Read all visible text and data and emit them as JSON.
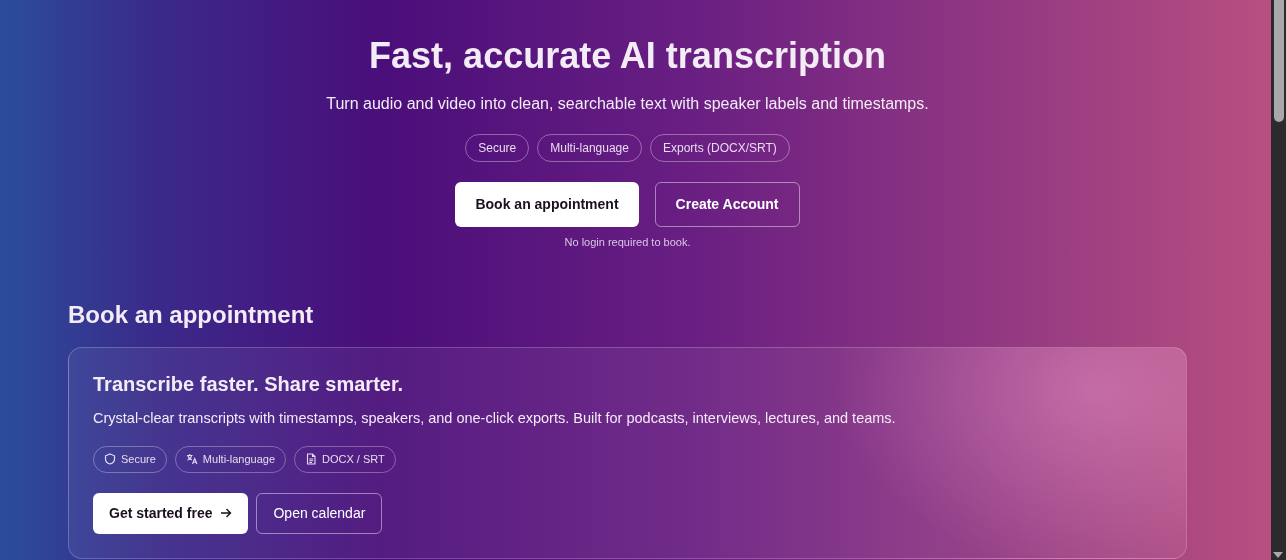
{
  "hero": {
    "title": "Fast, accurate AI transcription",
    "subtitle": "Turn audio and video into clean, searchable text with speaker labels and timestamps.",
    "tags": [
      "Secure",
      "Multi-language",
      "Exports (DOCX/SRT)"
    ],
    "buttons": [
      {
        "label": "Book an appointment",
        "kind": "primary"
      },
      {
        "label": "Create Account",
        "kind": "outline"
      }
    ],
    "note": "No login required to book."
  },
  "section": {
    "heading": "Book an appointment",
    "card": {
      "title": "Transcribe faster. Share smarter.",
      "text": "Crystal-clear transcripts with timestamps, speakers, and one-click exports. Built for podcasts, interviews, lectures, and teams.",
      "chips": [
        {
          "label": "Secure",
          "kind": "shield"
        },
        {
          "label": "Multi-language",
          "kind": "translate"
        },
        {
          "label": "DOCX / SRT",
          "kind": "document"
        }
      ],
      "buttons": [
        {
          "label": "Get started free",
          "kind": "primary"
        },
        {
          "label": "Open calendar",
          "kind": "outline"
        }
      ]
    }
  }
}
